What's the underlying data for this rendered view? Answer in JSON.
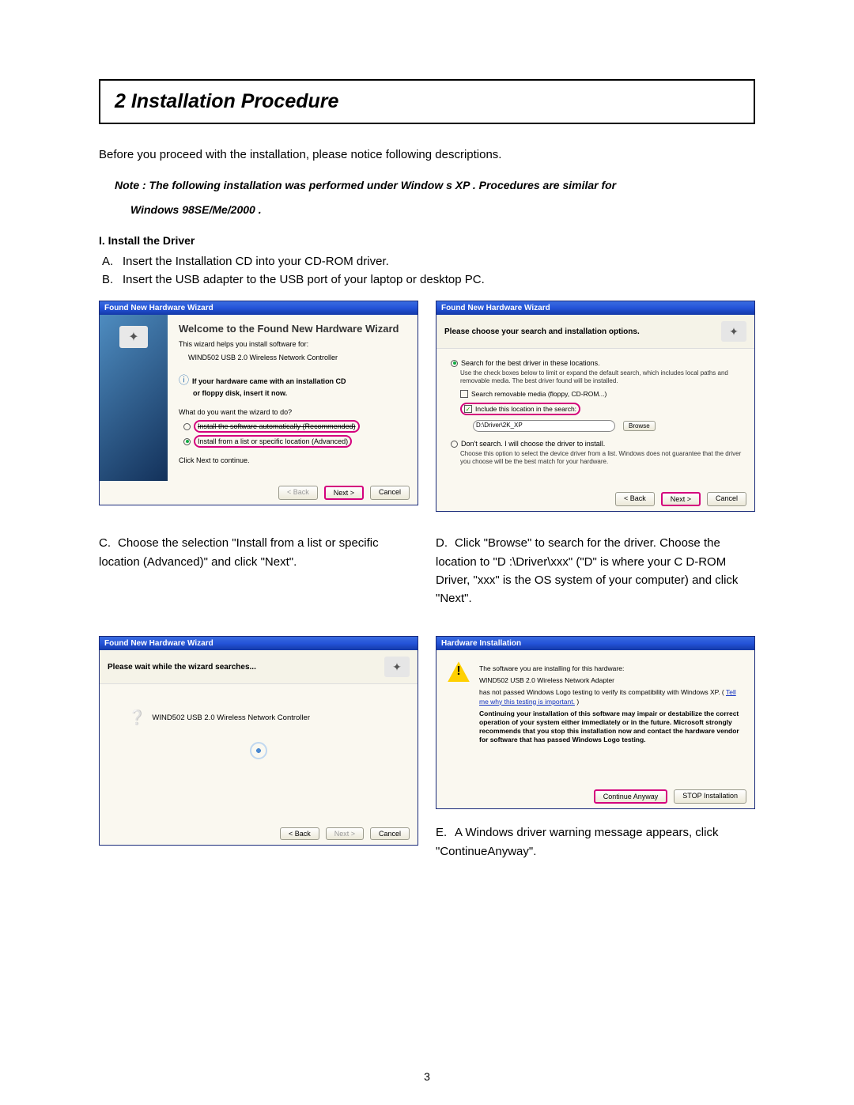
{
  "header": {
    "title": "2  Installation Procedure"
  },
  "intro": "Before you proceed with the installation, please notice following descriptions.",
  "note_line1": "Note : The following installation was performed under Window s XP .    Procedures are similar for",
  "note_line2": "Windows 98SE/Me/2000 .",
  "section1_title": "I. Install the Driver",
  "step_a": "Insert the Installation CD into your CD-ROM driver.",
  "step_b": "Insert the USB adapter to the USB port of your laptop or desktop PC.",
  "caption_c": "Choose the selection \"Install from a list or specific location (Advanced)\" and click \"Next\".",
  "caption_d": "Click \"Browse\" to search for the driver. Choose the location to \"D :\\Driver\\xxx\" (\"D\" is where your C D-ROM Driver, \"xxx\" is the OS system of your computer) and click \"Next\".",
  "caption_e": "A Windows driver warning message appears, click \"ContinueAnyway\".",
  "pagenum": "3",
  "dlg1": {
    "title": "Found New Hardware Wizard",
    "heading": "Welcome to the Found New Hardware Wizard",
    "help": "This wizard helps you install software for:",
    "device": "WIND502 USB 2.0 Wireless Network Controller",
    "cd_hint1": "If your hardware came with an installation CD",
    "cd_hint2": "or floppy disk, insert it now.",
    "prompt": "What do you want the wizard to do?",
    "radio1": "Install the software automatically (Recommended)",
    "radio2": "Install from a list or specific location (Advanced)",
    "cont": "Click Next to continue.",
    "back": "< Back",
    "next": "Next >",
    "cancel": "Cancel"
  },
  "dlg2": {
    "title": "Found New Hardware Wizard",
    "heading": "Please choose your search and installation options.",
    "radio_search": "Search for the best driver in these locations.",
    "subtext_search": "Use the check boxes below to limit or expand the default search, which includes local paths and removable media. The best driver found will be installed.",
    "chk1": "Search removable media (floppy, CD-ROM...)",
    "chk2": "Include this location in the search:",
    "path": "D:\\Driver\\2K_XP",
    "browse": "Browse",
    "radio_dont": "Don't search. I will choose the driver to install.",
    "subtext_dont": "Choose this option to select the device driver from a list. Windows does not guarantee that the driver you choose will be the best match for your hardware.",
    "back": "< Back",
    "next": "Next >",
    "cancel": "Cancel"
  },
  "dlg3": {
    "title": "Found New Hardware Wizard",
    "heading": "Please wait while the wizard searches...",
    "device": "WIND502 USB 2.0 Wireless Network Controller",
    "back": "< Back",
    "next": "Next >",
    "cancel": "Cancel"
  },
  "dlg4": {
    "title": "Hardware Installation",
    "line1": "The software you are installing for this hardware:",
    "device": "WIND502 USB 2.0 Wireless Network Adapter",
    "line2a": "has not passed Windows Logo testing to verify its compatibility with Windows XP. (",
    "link": "Tell me why this testing is important.",
    "line2b": ")",
    "strong": "Continuing your installation of this software may impair or destabilize the correct operation of your system either immediately or in the future. Microsoft strongly recommends that you stop this installation now and contact the hardware vendor for software that has passed Windows Logo testing.",
    "cont": "Continue Anyway",
    "stop": "STOP Installation"
  }
}
